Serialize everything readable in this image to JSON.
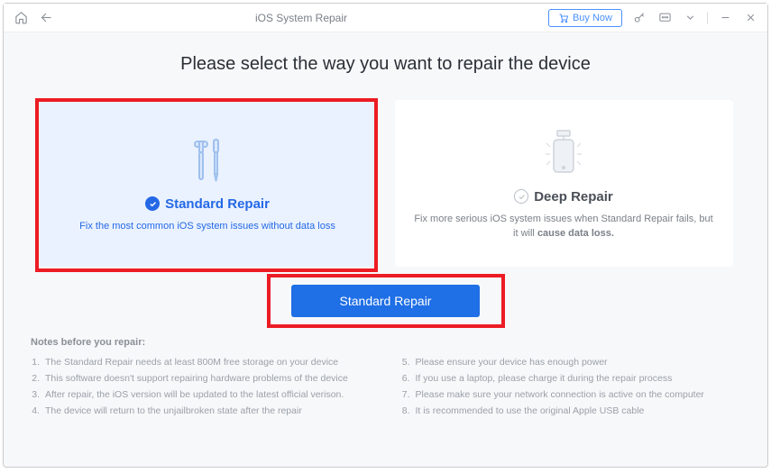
{
  "titlebar": {
    "title": "iOS System Repair",
    "buy_label": "Buy Now"
  },
  "page_title": "Please select the way you want to repair the device",
  "standard_card": {
    "title": "Standard Repair",
    "desc": "Fix the most common iOS system issues without data loss"
  },
  "deep_card": {
    "title": "Deep Repair",
    "desc_pre": "Fix more serious iOS system issues when Standard Repair fails, but it will ",
    "desc_bold": "cause data loss."
  },
  "action_button": "Standard Repair",
  "notes_title": "Notes before you repair:",
  "notes": {
    "n1": "The Standard Repair needs at least 800M free storage on your device",
    "n2": "This software doesn't support repairing hardware problems of the device",
    "n3": "After repair, the iOS version will be updated to the latest official verison.",
    "n4": "The device will return to the unjailbroken state after the repair",
    "n5": "Please ensure your device has enough power",
    "n6": "If you use a laptop, please charge it during the repair process",
    "n7": "Please make sure your network connection is active on the computer",
    "n8": "It is recommended to use the original Apple USB cable"
  }
}
